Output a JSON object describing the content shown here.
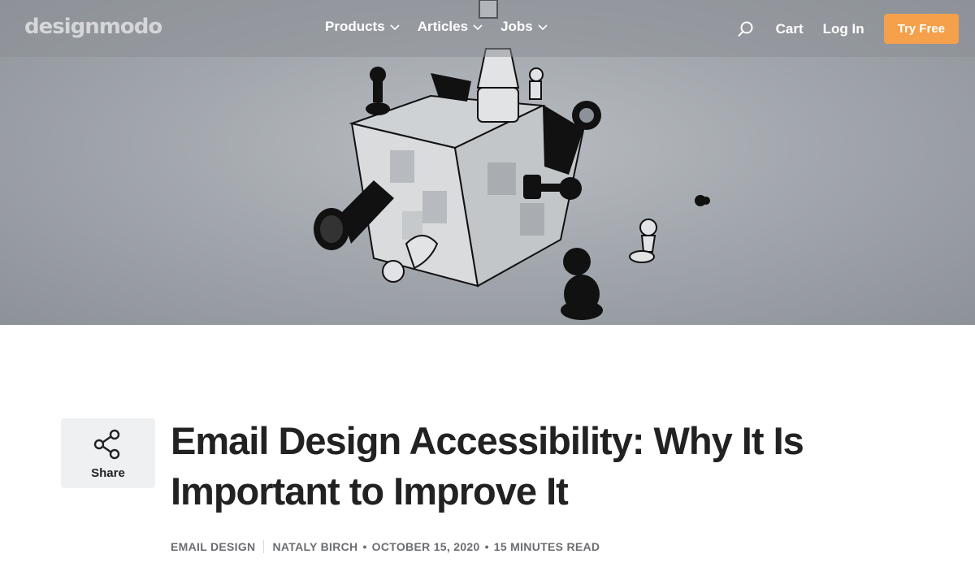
{
  "brand": {
    "logo_text": "designmodo"
  },
  "nav": {
    "items": [
      {
        "label": "Products"
      },
      {
        "label": "Articles"
      },
      {
        "label": "Jobs"
      }
    ],
    "cart_label": "Cart",
    "login_label": "Log In",
    "cta_label": "Try Free"
  },
  "colors": {
    "accent": "#f5a04a",
    "title": "#222222",
    "meta": "#6b6d70"
  },
  "article": {
    "share_label": "Share",
    "title": "Email Design Accessibility: Why It Is Important to Improve It",
    "category": "EMAIL DESIGN",
    "author": "NATALY BIRCH",
    "date": "OCTOBER 15, 2020",
    "read_time": "15 MINUTES READ"
  }
}
